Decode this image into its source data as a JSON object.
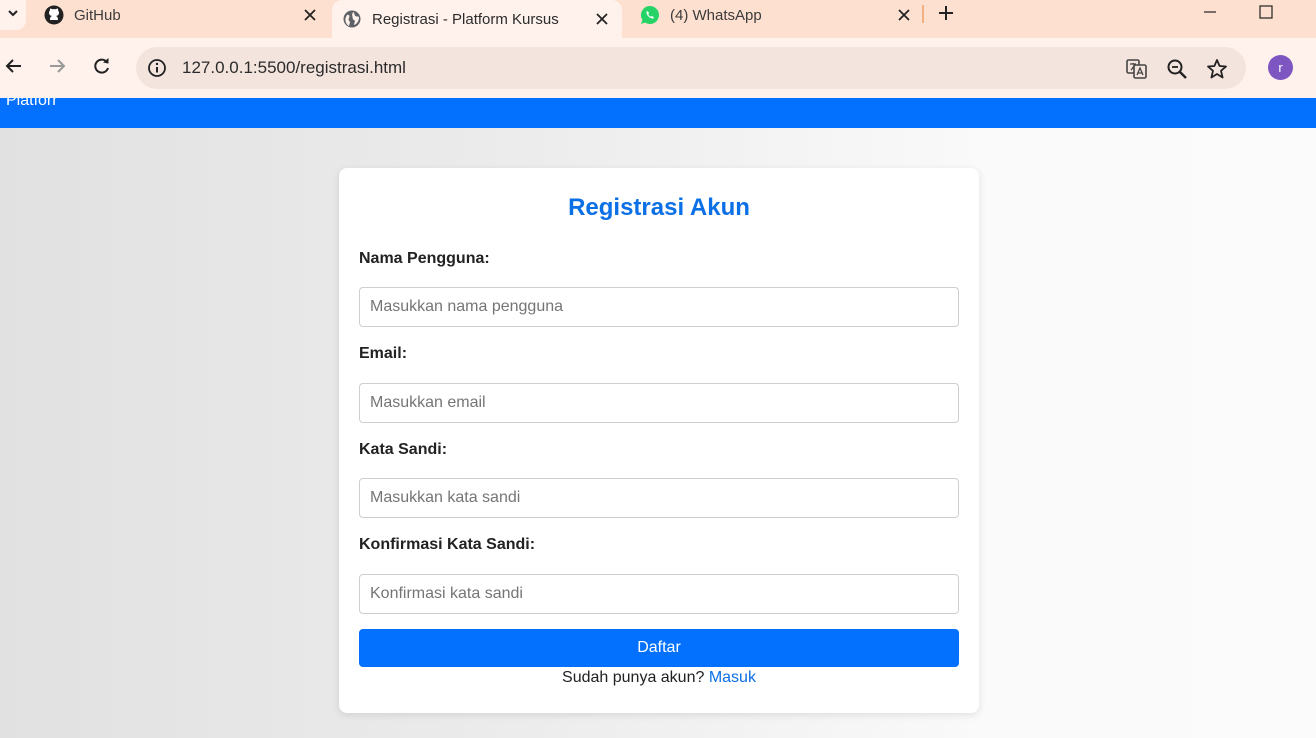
{
  "browser": {
    "tabs": [
      {
        "title": "GitHub",
        "icon": "github-icon"
      },
      {
        "title": "Registrasi - Platform Kursus",
        "icon": "globe-icon",
        "active": true
      },
      {
        "title": "(4) WhatsApp",
        "icon": "whatsapp-icon"
      }
    ],
    "url": "127.0.0.1:5500/registrasi.html",
    "profile_initial": "r",
    "accent_colors": {
      "tabstrip": "#fde0cf",
      "toolbar": "#fff2ec",
      "profile": "#7d56c2"
    }
  },
  "appbar": {
    "brand": "Platforr",
    "color": "#0371fd"
  },
  "form": {
    "title": "Registrasi Akun",
    "fields": [
      {
        "label": "Nama Pengguna:",
        "placeholder": "Masukkan nama pengguna",
        "value": ""
      },
      {
        "label": "Email:",
        "placeholder": "Masukkan email",
        "value": ""
      },
      {
        "label": "Kata Sandi:",
        "placeholder": "Masukkan kata sandi",
        "value": ""
      },
      {
        "label": "Konfirmasi Kata Sandi:",
        "placeholder": "Konfirmasi kata sandi",
        "value": ""
      }
    ],
    "submit_label": "Daftar",
    "footer_text": "Sudah punya akun?",
    "login_link": "Masuk"
  }
}
